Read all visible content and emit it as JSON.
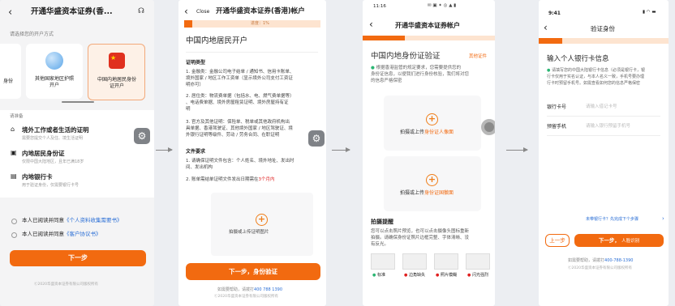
{
  "colors": {
    "accent": "#f26a10",
    "bg": "#eceef2"
  },
  "s1": {
    "title": "开通华盛资本证券(香...",
    "choose_label": "请选择您的开户方式",
    "card1": "身份",
    "card2": "其他国家地区护照\n开户",
    "card3": "中国内地居民身份\n证开户",
    "sec_label": "请准备",
    "items": [
      {
        "icon": "home-icon",
        "title": "境外工作或者生活的证明",
        "desc": "需要您提交个人及住、境生活证明"
      },
      {
        "icon": "id-icon",
        "title": "内地居民身份证",
        "desc": "仅限中国大陆地区，且年已满18岁"
      },
      {
        "icon": "card-icon",
        "title": "内地银行卡",
        "desc": "用于验证身份，仅需要银行卡号"
      }
    ],
    "agree1_pre": "本人已阅读并同意",
    "agree1_link": "《个人资料收集需要书》",
    "agree2_pre": "本人已阅读并同意",
    "agree2_link": "《客户协议书》",
    "next": "下一步",
    "footer": "Ⓒ2020华盛资本证券有限公司版权所有"
  },
  "s2": {
    "close": "Close",
    "title": "开通华盛资本证券(香港)帐户",
    "progress_label": "进度：1%",
    "progress": 0.06,
    "heading": "中国内地居民开户",
    "doc_type": "证明类型",
    "p1": "1. 金融类：金融公司电子结单 / 通知书、信用卡账单、",
    "p1b": "境外国家 / 地区工作工资单（显示境外公司支付工资证",
    "p1c": "明亦可）",
    "p2": "2. 居住类：物流费单据（包括水、电、燃气费单据等）",
    "p2b": "、电话费单据、境外房屋租赁证明、境外房屋持有证",
    "p2c": "明",
    "p3": "3. 官方及其他证明：保险单、税单或其他政府机构出",
    "p3b": "具单据、香港驾驶证、其他境外国家 / 地区驾驶证、境",
    "p3c": "外银行证明等级件、劳动 / 劳务合同、在职证明",
    "req": "文件要求",
    "r1": "1. 请确保证明文件包含：个人姓名、境外地址、发出时",
    "r1b": "间、发出机构",
    "r2_pre": "2. 账单需结单证明文件发出日期需在",
    "r2_red": "3个月内",
    "upload": "拍摄或上传证明图片",
    "next": "下一步，身份验证",
    "help_pre": "如需要帮助，请拨打",
    "help_phone": "400 788 1390",
    "footer": "Ⓒ2020华盛资本证券有限公司版权所有"
  },
  "s3": {
    "time": "11:16",
    "title": "开通华盛资本证券帐户",
    "heading": "中国内地身份证验证",
    "other": "其他证件",
    "desc1": "根据香港监管的规定要求，您需要提供您的",
    "desc2": "身份证信息，以便我们进行身份核验，我们将对您",
    "desc3": "的信息严格保密",
    "up1_pre": "拍摄或上传",
    "up1_em": "身份证人像面",
    "up2_pre": "拍摄或上传",
    "up2_em": "身份证国徽面",
    "tips": "拍摄提醒",
    "tip1": "您可以点击照片预览，也可以点击摄像头图标重新",
    "tip2": "拍摄。请确保身份证照片边框完整、字体清晰、没",
    "tip3": "有反光。",
    "samples": [
      "标准",
      "边角缺失",
      "照片模糊",
      "闪光强烈"
    ]
  },
  "s4": {
    "time": "9:41",
    "title": "验证身份",
    "heading": "输入个人银行卡信息",
    "note1": "请填写您的中国大陆银行卡信息（必须是银行卡，银",
    "note2": "行卡仅用于实名认证，与本人名义一致，手机号要办理",
    "note3": "行卡时预留手机号。如需查看如何您的信息严格保密",
    "label_card": "银行卡号",
    "ph_card": "请输入借记卡号",
    "label_phone": "预留手机",
    "ph_phone": "请输入银行预留手机号",
    "unsupported": "未带银行卡？先完成下个步骤",
    "prev": "上一步",
    "next": "下一步，",
    "next2": "人脸识别",
    "help_pre": "如需要帮助，请拨打",
    "help_phone": "400-788-1390",
    "footer": "Ⓒ2020华盛资本证券有限公司版权所有"
  }
}
